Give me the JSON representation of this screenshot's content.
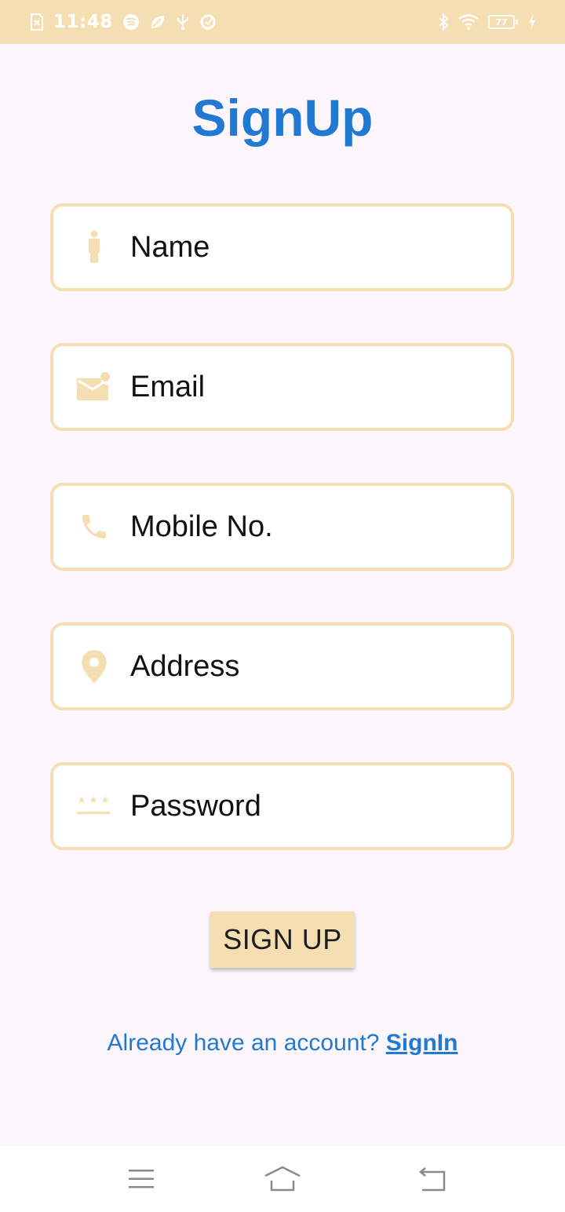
{
  "status_bar": {
    "time": "11:48",
    "battery_level": "77",
    "left_icons": [
      "sim-x-icon",
      "spotify-icon",
      "leaf-icon",
      "usb-icon",
      "sync-icon"
    ],
    "right_icons": [
      "bluetooth-icon",
      "wifi-icon",
      "battery-icon",
      "charging-icon"
    ]
  },
  "title": "SignUp",
  "fields": {
    "name": {
      "placeholder": "Name",
      "icon": "person-icon"
    },
    "email": {
      "placeholder": "Email",
      "icon": "email-icon"
    },
    "mobile": {
      "placeholder": "Mobile No.",
      "icon": "phone-icon"
    },
    "address": {
      "placeholder": "Address",
      "icon": "location-pin-icon"
    },
    "password": {
      "placeholder": "Password",
      "icon": "password-icon"
    }
  },
  "signup_button": {
    "label": "SIGN UP"
  },
  "signin_prompt": {
    "text": "Already have an account? ",
    "link": "SignIn"
  },
  "colors": {
    "accent": "#F4DEB2",
    "primary_text": "#2179D2",
    "background": "#FDF6FD"
  },
  "nav_bar": {
    "icons": [
      "menu-icon",
      "home-icon",
      "back-icon"
    ]
  }
}
